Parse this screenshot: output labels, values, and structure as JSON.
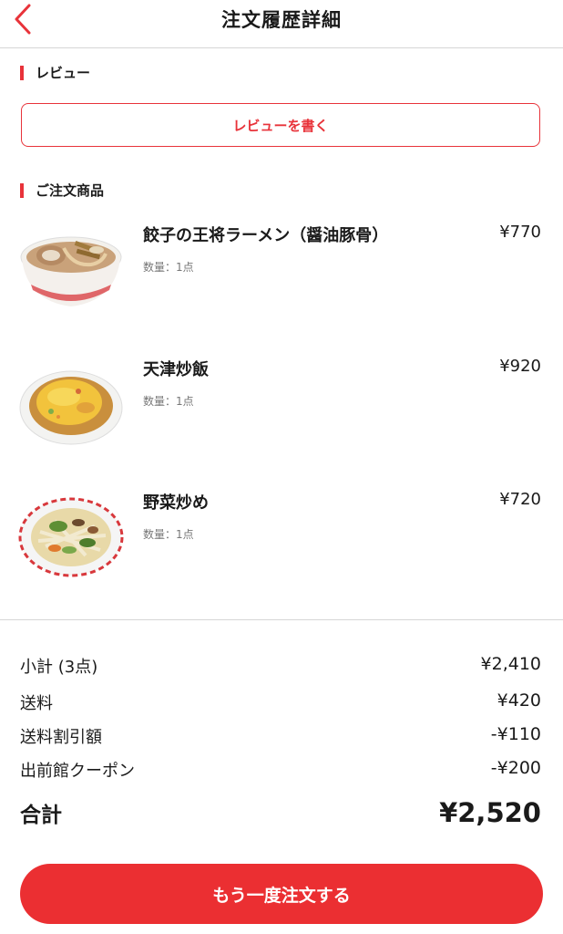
{
  "header": {
    "title": "注文履歴詳細",
    "back_icon": "chevron-left-icon",
    "accent_color": "#e8333a"
  },
  "review": {
    "section_label": "レビュー",
    "button_label": "レビューを書く"
  },
  "order": {
    "section_label": "ご注文商品",
    "items": [
      {
        "name": "餃子の王将ラーメン（醤油豚骨）",
        "price": "¥770",
        "quantity": "数量：1点"
      },
      {
        "name": "天津炒飯",
        "price": "¥920",
        "quantity": "数量：1点"
      },
      {
        "name": "野菜炒め",
        "price": "¥720",
        "quantity": "数量：1点"
      }
    ]
  },
  "summary": {
    "subtotal_label": "小計 (3点)",
    "subtotal_value": "¥2,410",
    "shipping_label": "送料",
    "shipping_value": "¥420",
    "shipping_discount_label": "送料割引額",
    "shipping_discount_value": "-¥110",
    "coupon_label": "出前館クーポン",
    "coupon_value": "-¥200",
    "total_label": "合計",
    "total_value": "¥2,520"
  },
  "reorder": {
    "button_label": "もう一度注文する",
    "button_color": "#eb2f32"
  }
}
